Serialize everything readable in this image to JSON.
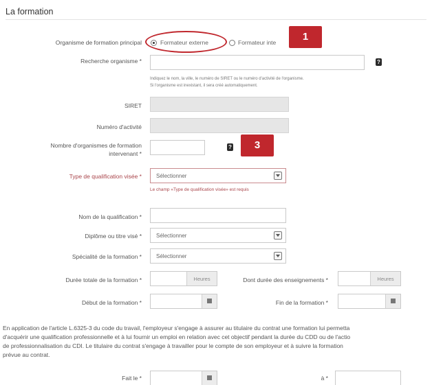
{
  "section": {
    "title": "La formation"
  },
  "organisme": {
    "label": "Organisme de formation principal",
    "option_externe": "Formateur externe",
    "option_interne": "Formateur inte"
  },
  "recherche": {
    "label": "Recherche organisme *",
    "value": "",
    "hint_line1": "Indiquez le nom, la ville, le numéro de SIRET ou le numéro d'activité de l'organisme.",
    "hint_line2": "Si l'organisme est inexistant, il sera créé automatiquement."
  },
  "siret": {
    "label": "SIRET"
  },
  "numero_activite": {
    "label": "Numéro d'activité"
  },
  "nombre_organismes": {
    "label_line1": "Nombre d'organismes de formation",
    "label_line2": "intervenant *"
  },
  "type_qualification": {
    "label": "Type de qualification visée *",
    "selected": "Sélectionner",
    "error": "Le champ «Type de qualification visée» est requis"
  },
  "nom_qualification": {
    "label": "Nom de la qualification *"
  },
  "diplome": {
    "label": "Diplôme ou titre visé *",
    "selected": "Sélectionner"
  },
  "specialite": {
    "label": "Spécialité de la formation *",
    "selected": "Sélectionner"
  },
  "duree_totale": {
    "label": "Durée totale de la formation *",
    "unit": "Heures"
  },
  "duree_enseignements": {
    "label": "Dont durée des enseignements *",
    "unit": "Heures"
  },
  "debut": {
    "label": "Début de la formation *"
  },
  "fin": {
    "label": "Fin de la formation *"
  },
  "paragraph": "En application de l'article L.6325-3 du code du travail, l'employeur s'engage à assurer au titulaire du contrat une formation lui permetta\nd'acquérir une qualification professionnelle et à lui fournir un emploi en relation avec cet objectif pendant la durée du CDD ou de l'actio\nde professionnalisation du CDI. Le titulaire du contrat s'engage à travailler pour le compte de son employeur et à suivre la formation\nprévue au contrat.",
  "fait_le": {
    "label": "Fait le *"
  },
  "lieu": {
    "label": "à *"
  },
  "help_icon_glyph": "?",
  "annotations": {
    "badge1": "1",
    "badge3": "3",
    "color": "#c0272d"
  }
}
